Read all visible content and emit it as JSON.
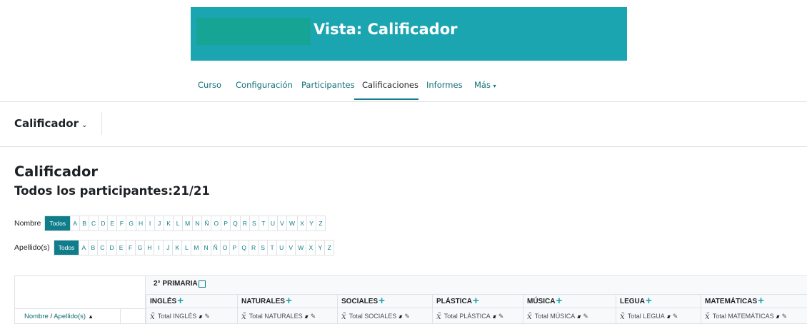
{
  "banner": {
    "title": "Vista: Calificador"
  },
  "nav": {
    "items": [
      "Curso",
      "Configuración",
      "Participantes",
      "Calificaciones",
      "Informes",
      "Más"
    ],
    "active": "Calificaciones"
  },
  "selector": {
    "label": "Calificador"
  },
  "page": {
    "title": "Calificador",
    "participants": "Todos los participantes:21/21"
  },
  "filters": {
    "name_label": "Nombre",
    "surname_label": "Apellido(s)",
    "all_label": "Todos",
    "letters": [
      "A",
      "B",
      "C",
      "D",
      "E",
      "F",
      "G",
      "H",
      "I",
      "J",
      "K",
      "L",
      "M",
      "N",
      "Ñ",
      "O",
      "P",
      "Q",
      "R",
      "S",
      "T",
      "U",
      "V",
      "W",
      "X",
      "Y",
      "Z"
    ]
  },
  "table": {
    "category": "2° PRIMARIA",
    "sort_first": "Nombre",
    "sort_sep": "/",
    "sort_second": "Apellido(s)",
    "subjects": [
      {
        "name": "INGLÉS",
        "total": "Total INGLÉS"
      },
      {
        "name": "NATURALES",
        "total": "Total NATURALES"
      },
      {
        "name": "SOCIALES",
        "total": "Total SOCIALES"
      },
      {
        "name": "PLÁSTICA",
        "total": "Total PLÁSTICA"
      },
      {
        "name": "MÚSICA",
        "total": "Total MÚSICA"
      },
      {
        "name": "LEGUA",
        "total": "Total LEGUA"
      },
      {
        "name": "MATEMÁTICAS",
        "total": "Total MATEMÁTICAS"
      }
    ]
  },
  "colors": {
    "banner": "#1aa5b0",
    "accent": "#0f7d8a",
    "link": "#0f6e78"
  }
}
